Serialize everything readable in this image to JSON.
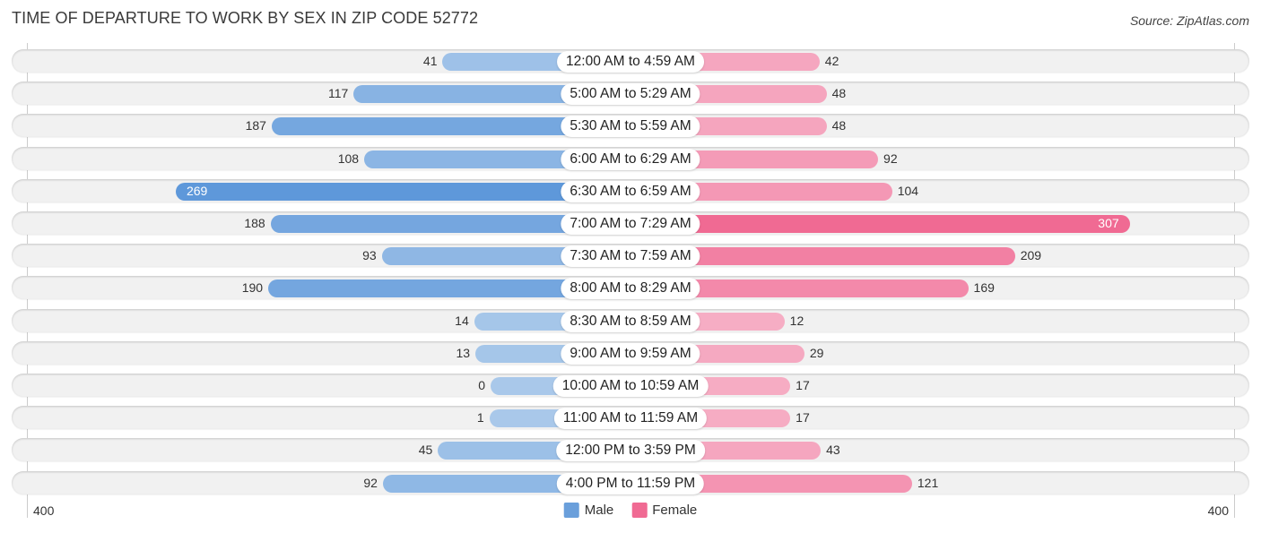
{
  "chart_data": {
    "type": "bar",
    "orientation": "horizontal-diverging",
    "title": "TIME OF DEPARTURE TO WORK BY SEX IN ZIP CODE 52772",
    "source": "Source: ZipAtlas.com",
    "categories": [
      "12:00 AM to 4:59 AM",
      "5:00 AM to 5:29 AM",
      "5:30 AM to 5:59 AM",
      "6:00 AM to 6:29 AM",
      "6:30 AM to 6:59 AM",
      "7:00 AM to 7:29 AM",
      "7:30 AM to 7:59 AM",
      "8:00 AM to 8:29 AM",
      "8:30 AM to 8:59 AM",
      "9:00 AM to 9:59 AM",
      "10:00 AM to 10:59 AM",
      "11:00 AM to 11:59 AM",
      "12:00 PM to 3:59 PM",
      "4:00 PM to 11:59 PM"
    ],
    "series": [
      {
        "name": "Male",
        "color": "#6a9fdb",
        "values": [
          41,
          117,
          187,
          108,
          269,
          188,
          93,
          190,
          14,
          13,
          0,
          1,
          45,
          92
        ]
      },
      {
        "name": "Female",
        "color": "#f06a93",
        "values": [
          42,
          48,
          48,
          92,
          104,
          307,
          209,
          169,
          12,
          29,
          17,
          17,
          43,
          121
        ]
      }
    ],
    "axis": {
      "left_tick": "400",
      "right_tick": "400",
      "range": [
        0,
        400
      ]
    },
    "legend": {
      "position": "bottom-center",
      "items": [
        "Male",
        "Female"
      ]
    }
  }
}
